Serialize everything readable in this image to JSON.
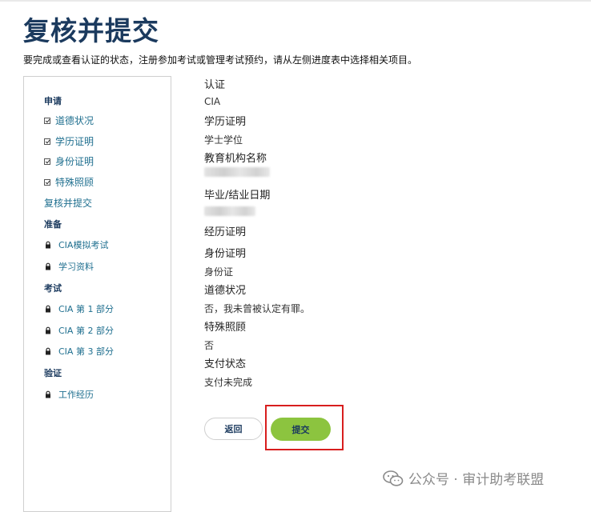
{
  "page": {
    "title": "复核并提交",
    "intro": "要完成或查看认证的状态，注册参加考试或管理考试预约，请从左侧进度表中选择相关项目。"
  },
  "sidebar": {
    "sections": [
      {
        "heading": "申请",
        "items": [
          {
            "label": "道德状况",
            "icon": "checkbox-checked-icon"
          },
          {
            "label": "学历证明",
            "icon": "checkbox-checked-icon"
          },
          {
            "label": "身份证明",
            "icon": "checkbox-checked-icon"
          },
          {
            "label": "特殊照顾",
            "icon": "checkbox-checked-icon"
          },
          {
            "label": "复核并提交",
            "icon": ""
          }
        ]
      },
      {
        "heading": "准备",
        "items": [
          {
            "label": "CIA模拟考试",
            "icon": "lock-icon"
          },
          {
            "label": "学习资料",
            "icon": "lock-icon"
          }
        ]
      },
      {
        "heading": "考试",
        "items": [
          {
            "label": "CIA 第 1 部分",
            "icon": "lock-icon"
          },
          {
            "label": "CIA 第 2 部分",
            "icon": "lock-icon"
          },
          {
            "label": "CIA 第 3 部分",
            "icon": "lock-icon"
          }
        ]
      },
      {
        "heading": "验证",
        "items": [
          {
            "label": "工作经历",
            "icon": "lock-icon"
          }
        ]
      }
    ]
  },
  "summary": {
    "certification_label": "认证",
    "certification_value": "CIA",
    "education_label": "学历证明",
    "education_value": "学士学位",
    "institution_label": "教育机构名称",
    "graduation_label": "毕业/结业日期",
    "experience_label": "经历证明",
    "identity_label": "身份证明",
    "identity_value": "身份证",
    "ethics_label": "道德状况",
    "ethics_value": "否，我未曾被认定有罪。",
    "accommodation_label": "特殊照顾",
    "accommodation_value": "否",
    "payment_label": "支付状态",
    "payment_value": "支付未完成"
  },
  "actions": {
    "back_label": "返回",
    "submit_label": "提交"
  },
  "watermark": {
    "text": "公众号 · 审计助考联盟"
  },
  "colors": {
    "title": "#1b3a5e",
    "link": "#1f6f8f",
    "submit": "#8cc43f",
    "highlight": "#d81e1e"
  }
}
